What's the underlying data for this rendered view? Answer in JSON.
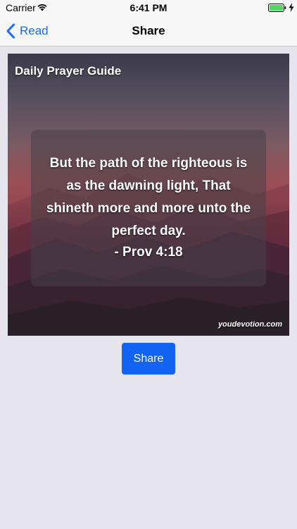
{
  "status_bar": {
    "carrier": "Carrier",
    "time": "6:41 PM",
    "wifi_icon": "wifi-icon",
    "battery_icon": "battery-full-icon",
    "charging_icon": "charging-bolt-icon",
    "battery_color": "#4cd964"
  },
  "nav": {
    "back_label": "Read",
    "back_icon": "chevron-left-icon",
    "title": "Share",
    "accent_color": "#1a6cf6"
  },
  "card": {
    "brand": "Daily Prayer Guide",
    "quote_text": "But the path of the righteous is as the dawning light, That shineth more and more unto the perfect day.",
    "quote_reference": "- Prov 4:18",
    "website": "youdevotion.com"
  },
  "actions": {
    "share_label": "Share",
    "share_color": "#1264f5"
  }
}
